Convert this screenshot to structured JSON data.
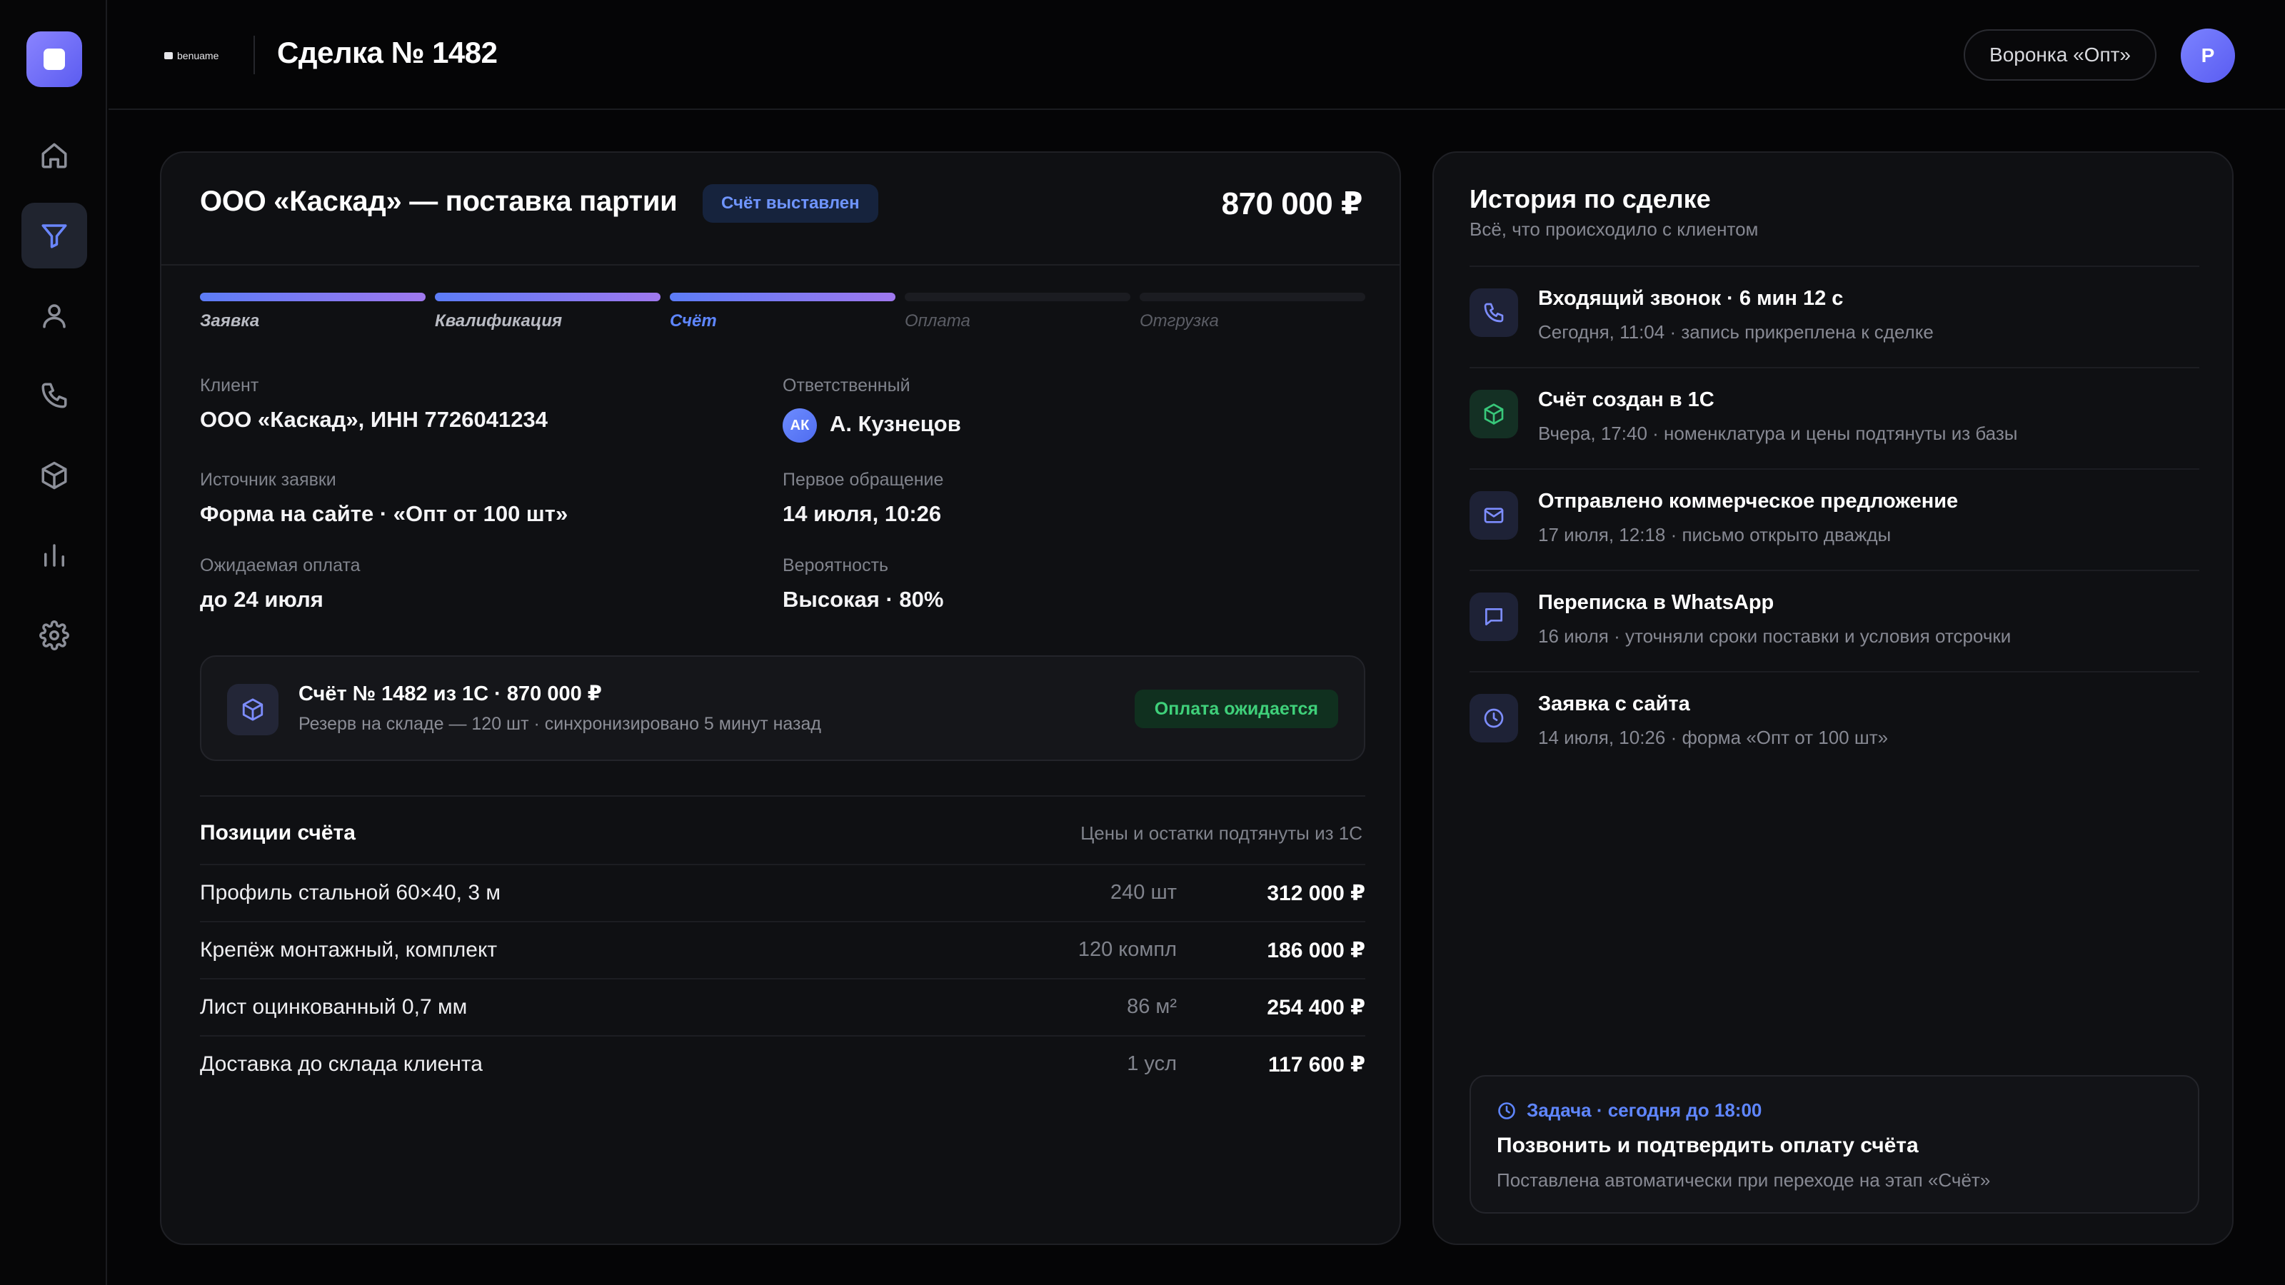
{
  "app": {
    "brand_name": "benuame",
    "accent_color": "#6a86ff"
  },
  "sidebar": {
    "items": [
      {
        "icon": "home-icon",
        "active": false
      },
      {
        "icon": "funnel-icon",
        "active": true
      },
      {
        "icon": "user-icon",
        "active": false
      },
      {
        "icon": "phone-icon",
        "active": false
      },
      {
        "icon": "box-icon",
        "active": false
      },
      {
        "icon": "chart-icon",
        "active": false
      },
      {
        "icon": "gear-icon",
        "active": false
      }
    ]
  },
  "header": {
    "title": "Сделка № 1482",
    "funnel_label": "Воронка «Опт»",
    "avatar_initial": "Р"
  },
  "deal": {
    "title": "ООО «Каскад» — поставка партии",
    "badge": "Счёт выставлен",
    "amount": "870 000 ₽",
    "stages": [
      {
        "label": "Заявка",
        "state": "done"
      },
      {
        "label": "Квалификация",
        "state": "done"
      },
      {
        "label": "Счёт",
        "state": "current"
      },
      {
        "label": "Оплата",
        "state": "todo"
      },
      {
        "label": "Отгрузка",
        "state": "todo"
      }
    ],
    "fields": {
      "client_label": "Клиент",
      "client_value": "ООО «Каскад», ИНН 7726041234",
      "responsible_label": "Ответственный",
      "responsible_initials": "АК",
      "responsible_value": "А. Кузнецов",
      "source_label": "Источник заявки",
      "source_value": "Форма на сайте · «Опт от 100 шт»",
      "first_contact_label": "Первое обращение",
      "first_contact_value": "14 июля, 10:26",
      "expected_payment_label": "Ожидаемая оплата",
      "expected_payment_value": "до 24 июля",
      "probability_label": "Вероятность",
      "probability_value": "Высокая · 80%"
    },
    "invoice": {
      "title": "Счёт № 1482 из 1С · 870 000 ₽",
      "subtitle": "Резерв на складе — 120 шт · синхронизировано 5 минут назад",
      "status": "Оплата ожидается"
    },
    "items_section": {
      "title": "Позиции счёта",
      "note": "Цены и остатки подтянуты из 1С",
      "rows": [
        {
          "name": "Профиль стальной 60×40, 3 м",
          "qty": "240 шт",
          "sum": "312 000 ₽"
        },
        {
          "name": "Крепёж монтажный, комплект",
          "qty": "120 компл",
          "sum": "186 000 ₽"
        },
        {
          "name": "Лист оцинкованный 0,7 мм",
          "qty": "86 м²",
          "sum": "254 400 ₽"
        },
        {
          "name": "Доставка до склада клиента",
          "qty": "1 усл",
          "sum": "117 600 ₽"
        }
      ]
    }
  },
  "history": {
    "title": "История по сделке",
    "subtitle": "Всё, что происходило с клиентом",
    "events": [
      {
        "icon": "phone-icon",
        "head": "Входящий звонок · 6 мин 12 с",
        "text": "Сегодня, 11:04 · запись прикреплена к сделке"
      },
      {
        "icon": "box-icon",
        "head": "Счёт создан в 1С",
        "text": "Вчера, 17:40 · номенклатура и цены подтянуты из базы"
      },
      {
        "icon": "mail-icon",
        "head": "Отправлено коммерческое предложение",
        "text": "17 июля, 12:18 · письмо открыто дважды"
      },
      {
        "icon": "chat-icon",
        "head": "Переписка в WhatsApp",
        "text": "16 июля · уточняли сроки поставки и условия отсрочки"
      },
      {
        "icon": "clock-icon",
        "head": "Заявка с сайта",
        "text": "14 июля, 10:26 · форма «Опт от 100 шт»"
      }
    ],
    "task": {
      "meta": "Задача · сегодня до 18:00",
      "title": "Позвонить и подтвердить оплату счёта",
      "subtitle": "Поставлена автоматически при переходе на этап «Счёт»"
    }
  }
}
